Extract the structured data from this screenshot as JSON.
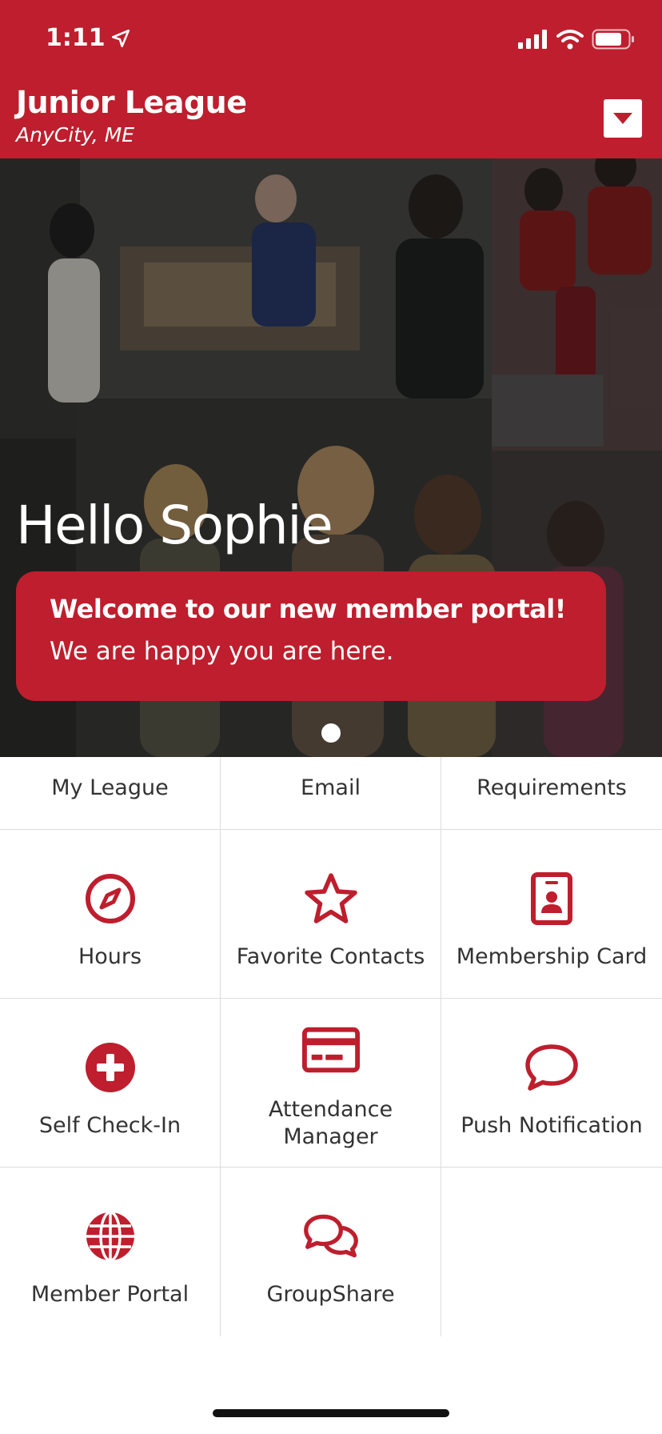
{
  "status_bar": {
    "time": "1:11"
  },
  "header": {
    "title": "Junior League",
    "subtitle": "AnyCity, ME"
  },
  "hero": {
    "greeting": "Hello Sophie",
    "card_title": "Welcome to our new member portal!",
    "card_subtitle": "We are happy you are here."
  },
  "tiles": [
    {
      "label": "My League",
      "icon": "qr-code-icon"
    },
    {
      "label": "Email",
      "icon": "question-circle-icon"
    },
    {
      "label": "Requirements",
      "icon": "checkbox-icon"
    },
    {
      "label": "Hours",
      "icon": "compass-icon"
    },
    {
      "label": "Favorite Contacts",
      "icon": "star-icon"
    },
    {
      "label": "Membership Card",
      "icon": "id-badge-icon"
    },
    {
      "label": "Self Check-In",
      "icon": "plus-circle-icon"
    },
    {
      "label": "Attendance Manager",
      "line1": "Attendance",
      "line2": "Manager",
      "icon": "credit-card-icon"
    },
    {
      "label": "Push Notification",
      "icon": "speech-bubble-icon"
    },
    {
      "label": "Member Portal",
      "icon": "globe-icon"
    },
    {
      "label": "GroupShare",
      "icon": "chat-bubbles-icon"
    }
  ],
  "colors": {
    "brand": "#be1e2d"
  }
}
